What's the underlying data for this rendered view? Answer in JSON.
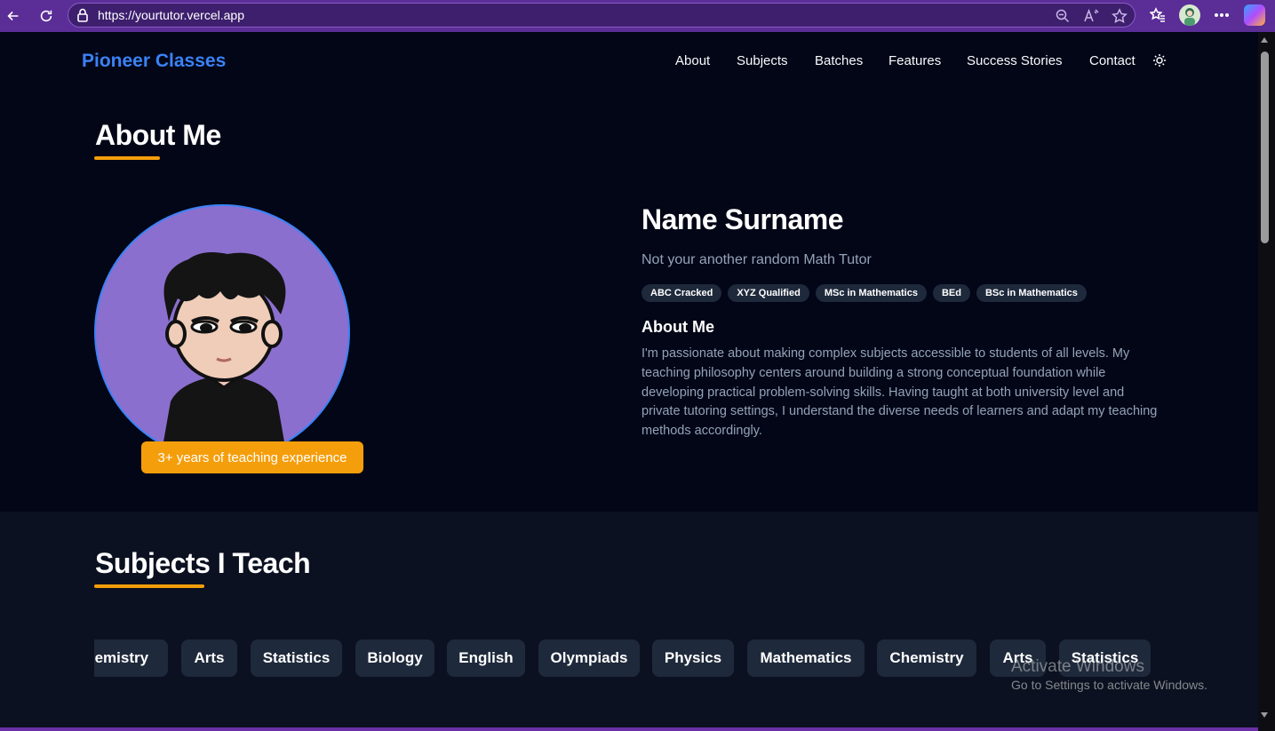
{
  "browser": {
    "url": "https://yourtutor.vercel.app"
  },
  "nav": {
    "brand": "Pioneer Classes",
    "links": [
      "About",
      "Subjects",
      "Batches",
      "Features",
      "Success Stories",
      "Contact"
    ]
  },
  "about": {
    "section_title": "About Me",
    "experience_badge": "3+ years of teaching experience",
    "name": "Name Surname",
    "tagline": "Not your another random Math Tutor",
    "badges": [
      "ABC Cracked",
      "XYZ Qualified",
      "MSc in Mathematics",
      "BEd",
      "BSc in Mathematics"
    ],
    "subheading": "About Me",
    "body": "I'm passionate about making complex subjects accessible to students of all levels. My teaching philosophy centers around building a strong conceptual foundation while developing practical problem-solving skills. Having taught at both university level and private tutoring settings, I understand the diverse needs of learners and adapt my teaching methods accordingly."
  },
  "subjects": {
    "section_title": "Subjects I Teach",
    "chips": [
      "Chemistry",
      "Arts",
      "Statistics",
      "Biology",
      "English",
      "Olympiads",
      "Physics",
      "Mathematics",
      "Chemistry",
      "Arts",
      "Statistics"
    ]
  },
  "watermark": {
    "title": "Activate Windows",
    "subtitle": "Go to Settings to activate Windows."
  },
  "colors": {
    "accent": "#f59e0b",
    "brand": "#3b82f6",
    "background": "#020617"
  }
}
